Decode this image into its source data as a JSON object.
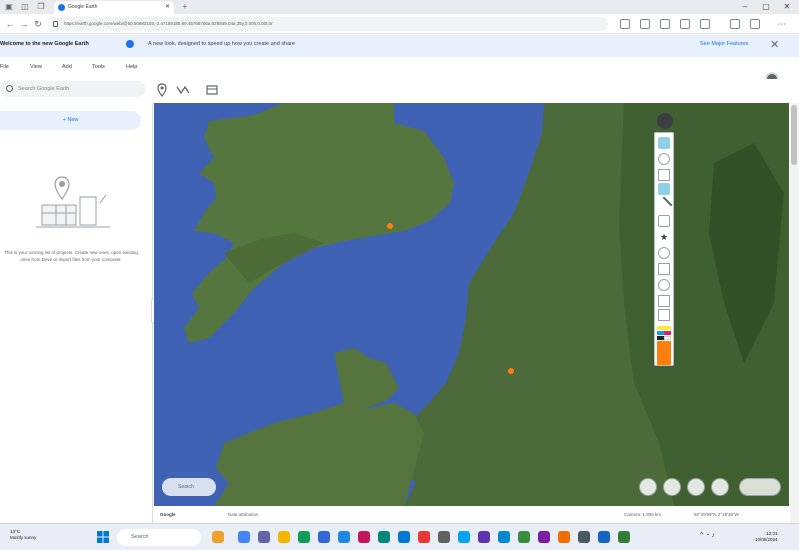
{
  "browser": {
    "tab_title": "Google Earth",
    "url": "https://earth.google.com/web/@50.50983103,-2.47189185,99.45768766a,628849.04a,35y,0.00h,0.00t,0r",
    "controls": {
      "minimize": "–",
      "maximize": "▢",
      "close": "✕"
    }
  },
  "banner": {
    "title": "Welcome to the new Google Earth",
    "text": "A new look, designed to speed up how you create and share",
    "link": "See Major Features",
    "close": "✕"
  },
  "menu": [
    "File",
    "View",
    "Add",
    "Tools",
    "Help"
  ],
  "toolbar": {
    "search_placeholder": "Search Google Earth"
  },
  "sidebar": {
    "new_button": "+  New",
    "empty_message": "This is your running list of projects. Create new ones, open existing ones from Drive or import files from your computer."
  },
  "map": {
    "search_pill": "Search",
    "attribution": [
      "Google",
      "Data attribution",
      "Camera: 1,800 km",
      "50°29'59\"N 2°28'36\"W"
    ],
    "drawing_colors": [
      "#ffffff",
      "#222222",
      "#ffeb3b",
      "#2196f3",
      "#e91e63",
      "#ff7f0e"
    ]
  },
  "taskbar": {
    "search_label": "Search",
    "weather_line1": "13°C",
    "weather_line2": "Mostly sunny",
    "time": "12:31",
    "date": "10/05/2024"
  }
}
